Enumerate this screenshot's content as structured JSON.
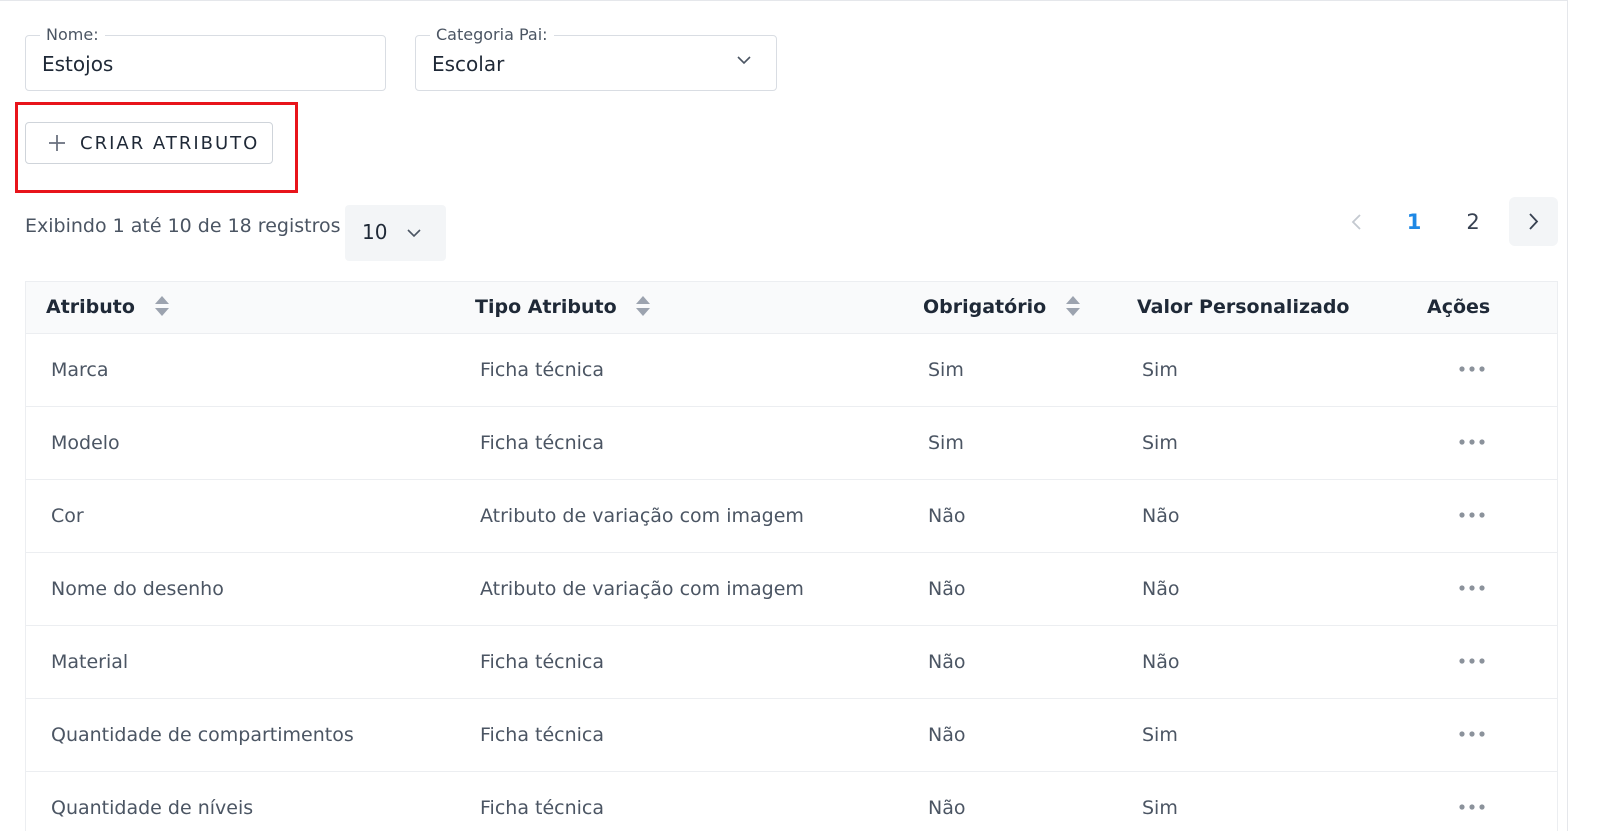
{
  "form": {
    "nome": {
      "label": "Nome:",
      "value": "Estojos"
    },
    "categoria_pai": {
      "label": "Categoria Pai:",
      "value": "Escolar"
    }
  },
  "create_button": {
    "label": "CRIAR ATRIBUTO",
    "icon": "plus-icon"
  },
  "highlight_color": "#e8141b",
  "records": {
    "text": "Exibindo 1 até 10 de 18 registros",
    "page_size": "10"
  },
  "pagination": {
    "pages": [
      "1",
      "2"
    ],
    "current": "1",
    "active_color": "#1e88e5"
  },
  "table": {
    "columns": [
      "Atributo",
      "Tipo Atributo",
      "Obrigatório",
      "Valor Personalizado",
      "Ações"
    ],
    "rows": [
      [
        "Marca",
        "Ficha técnica",
        "Sim",
        "Sim"
      ],
      [
        "Modelo",
        "Ficha técnica",
        "Sim",
        "Sim"
      ],
      [
        "Cor",
        "Atributo de variação com imagem",
        "Não",
        "Não"
      ],
      [
        "Nome do desenho",
        "Atributo de variação com imagem",
        "Não",
        "Não"
      ],
      [
        "Material",
        "Ficha técnica",
        "Não",
        "Não"
      ],
      [
        "Quantidade de compartimentos",
        "Ficha técnica",
        "Não",
        "Sim"
      ],
      [
        "Quantidade de níveis",
        "Ficha técnica",
        "Não",
        "Sim"
      ]
    ]
  }
}
